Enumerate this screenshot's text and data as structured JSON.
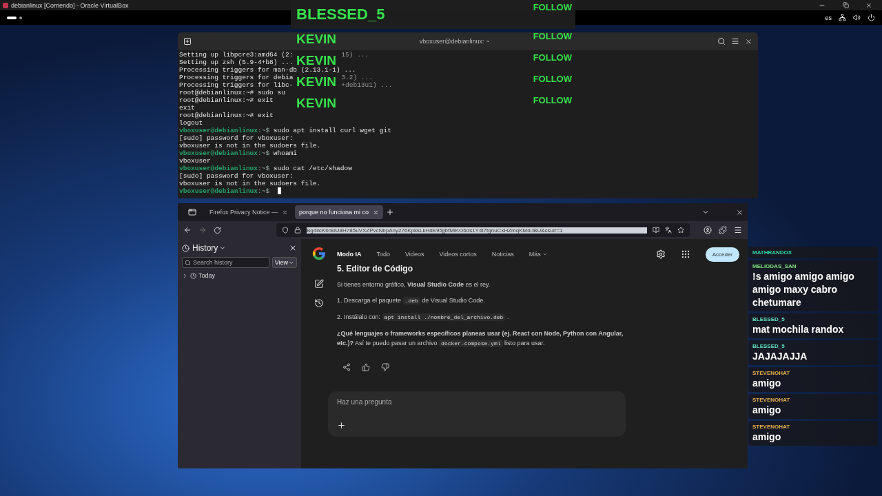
{
  "host_window": {
    "title": "debianlinux [Corriendo] - Oracle VirtualBox"
  },
  "guest_panel": {
    "keyboard_layout": "es"
  },
  "terminal": {
    "title": "vboxuser@debianlinux: ~",
    "lines": [
      {
        "kind": "output",
        "text": "Setting up libpcre3:amd64 (2:",
        "tail": "15) ..."
      },
      {
        "kind": "output",
        "text": "Setting up zsh (5.9-4+b8) ..."
      },
      {
        "kind": "output",
        "text": "Processing triggers for man-db (2.13.1-1) ..."
      },
      {
        "kind": "output",
        "text": "Processing triggers for debia",
        "tail": "3.2) ..."
      },
      {
        "kind": "output",
        "text": "Processing triggers for libc-",
        "tail": "+deb13u1) ..."
      },
      {
        "kind": "output",
        "text": "root@debianlinux:~# sudo su"
      },
      {
        "kind": "output",
        "text": "root@debianlinux:~# exit"
      },
      {
        "kind": "output",
        "text": "exit"
      },
      {
        "kind": "output",
        "text": "root@debianlinux:~# exit"
      },
      {
        "kind": "output",
        "text": "logout"
      },
      {
        "kind": "prompt",
        "user": "vboxuser@debianlinux",
        "symbol": ":~$",
        "command": "sudo apt install curl wget git"
      },
      {
        "kind": "output",
        "text": "[sudo] password for vboxuser:"
      },
      {
        "kind": "output",
        "text": "vboxuser is not in the sudoers file."
      },
      {
        "kind": "prompt",
        "user": "vboxuser@debianlinux",
        "symbol": ":~$",
        "command": "whoami"
      },
      {
        "kind": "output",
        "text": "vboxuser"
      },
      {
        "kind": "prompt",
        "user": "vboxuser@debianlinux",
        "symbol": ":~$",
        "command": "sudo cat /etc/shadow"
      },
      {
        "kind": "output",
        "text": "[sudo] password for vboxuser:"
      },
      {
        "kind": "output",
        "text": "vboxuser is not in the sudoers file."
      },
      {
        "kind": "prompt",
        "user": "vboxuser@debianlinux",
        "symbol": ":~$",
        "cursor": true
      }
    ]
  },
  "browser": {
    "tabs": [
      {
        "title": "Firefox Privacy Notice — ",
        "selected": false
      },
      {
        "title": "porque no funciona mi co",
        "selected": true
      }
    ],
    "url": "Bg4llcKbnklU8H785uVXZPvcNbpAny276KpkkLkHdE95jjbfMiKO6ds1Y4I7tgnuCkHZmqKMd-lBU&csuir=1",
    "sidebar": {
      "title": "History",
      "search_placeholder": "Search history",
      "view_button": "View",
      "items": [
        {
          "label": "Today",
          "expanded": false
        }
      ]
    },
    "nav_links": [
      {
        "label": "Modo IA",
        "selected": true
      },
      {
        "label": "Todo",
        "selected": false
      },
      {
        "label": "Videos",
        "selected": false
      },
      {
        "label": "Videos cortos",
        "selected": false
      },
      {
        "label": "Noticias",
        "selected": false
      },
      {
        "label": "Más",
        "selected": false,
        "dropdown": true
      }
    ],
    "sign_in_button": "Acceder",
    "answer": {
      "heading": "5. Editor de Código",
      "intro": "Si tienes entorno gráfico, **Visual Studio Code** es el rey.",
      "steps": [
        {
          "number": "1.",
          "parts": [
            {
              "text": "Descarga el paquete "
            },
            {
              "code": ".deb"
            },
            {
              "text": " de Visual Studio Code."
            }
          ]
        },
        {
          "number": "2.",
          "parts": [
            {
              "text": "Instálalo con: "
            },
            {
              "code": "apt install ./nombre_del_archivo.deb"
            },
            {
              "text": " ."
            }
          ]
        }
      ],
      "question": [
        {
          "bold": "¿Qué lenguajes o frameworks específicos planeas usar (ej. React con Node, Python con Angular, etc.)?"
        },
        {
          "text": " Así te puedo pasar un archivo "
        },
        {
          "code": "docker-compose.yml"
        },
        {
          "text": " listo para usar."
        }
      ]
    },
    "ask_placeholder": "Haz una pregunta"
  },
  "follow_alerts": [
    {
      "name": "BLESSED_5",
      "action": "FOLLOW",
      "highlighted": true
    },
    {
      "name": "KEVIN",
      "action": "FOLLOW",
      "highlighted": false
    },
    {
      "name": "KEVIN",
      "action": "FOLLOW",
      "highlighted": false
    },
    {
      "name": "KEVIN",
      "action": "FOLLOW",
      "highlighted": false
    },
    {
      "name": "KEVIN",
      "action": "FOLLOW",
      "highlighted": false
    }
  ],
  "chat": [
    {
      "user": "MATHRANDOX",
      "color": "#2fd6a4"
    },
    {
      "user": "MELIODAS_SAN",
      "color": "#7ee07e",
      "text": "!s amigo amigo amigo amigo maxy cabro chetumare"
    },
    {
      "user": "BLESSED_5",
      "color": "#5fe0c2",
      "text": "mat mochila randox"
    },
    {
      "user": "BLESSED_5",
      "color": "#5fe0c2",
      "text": "JAJAJAJJA"
    },
    {
      "user": "STEVENOHAT",
      "color": "#e8b04a",
      "text": "amigo"
    },
    {
      "user": "STEVENOHAT",
      "color": "#e8b04a",
      "text": "amigo"
    },
    {
      "user": "STEVENOHAT",
      "color": "#e8b04a",
      "text": "amigo"
    }
  ]
}
